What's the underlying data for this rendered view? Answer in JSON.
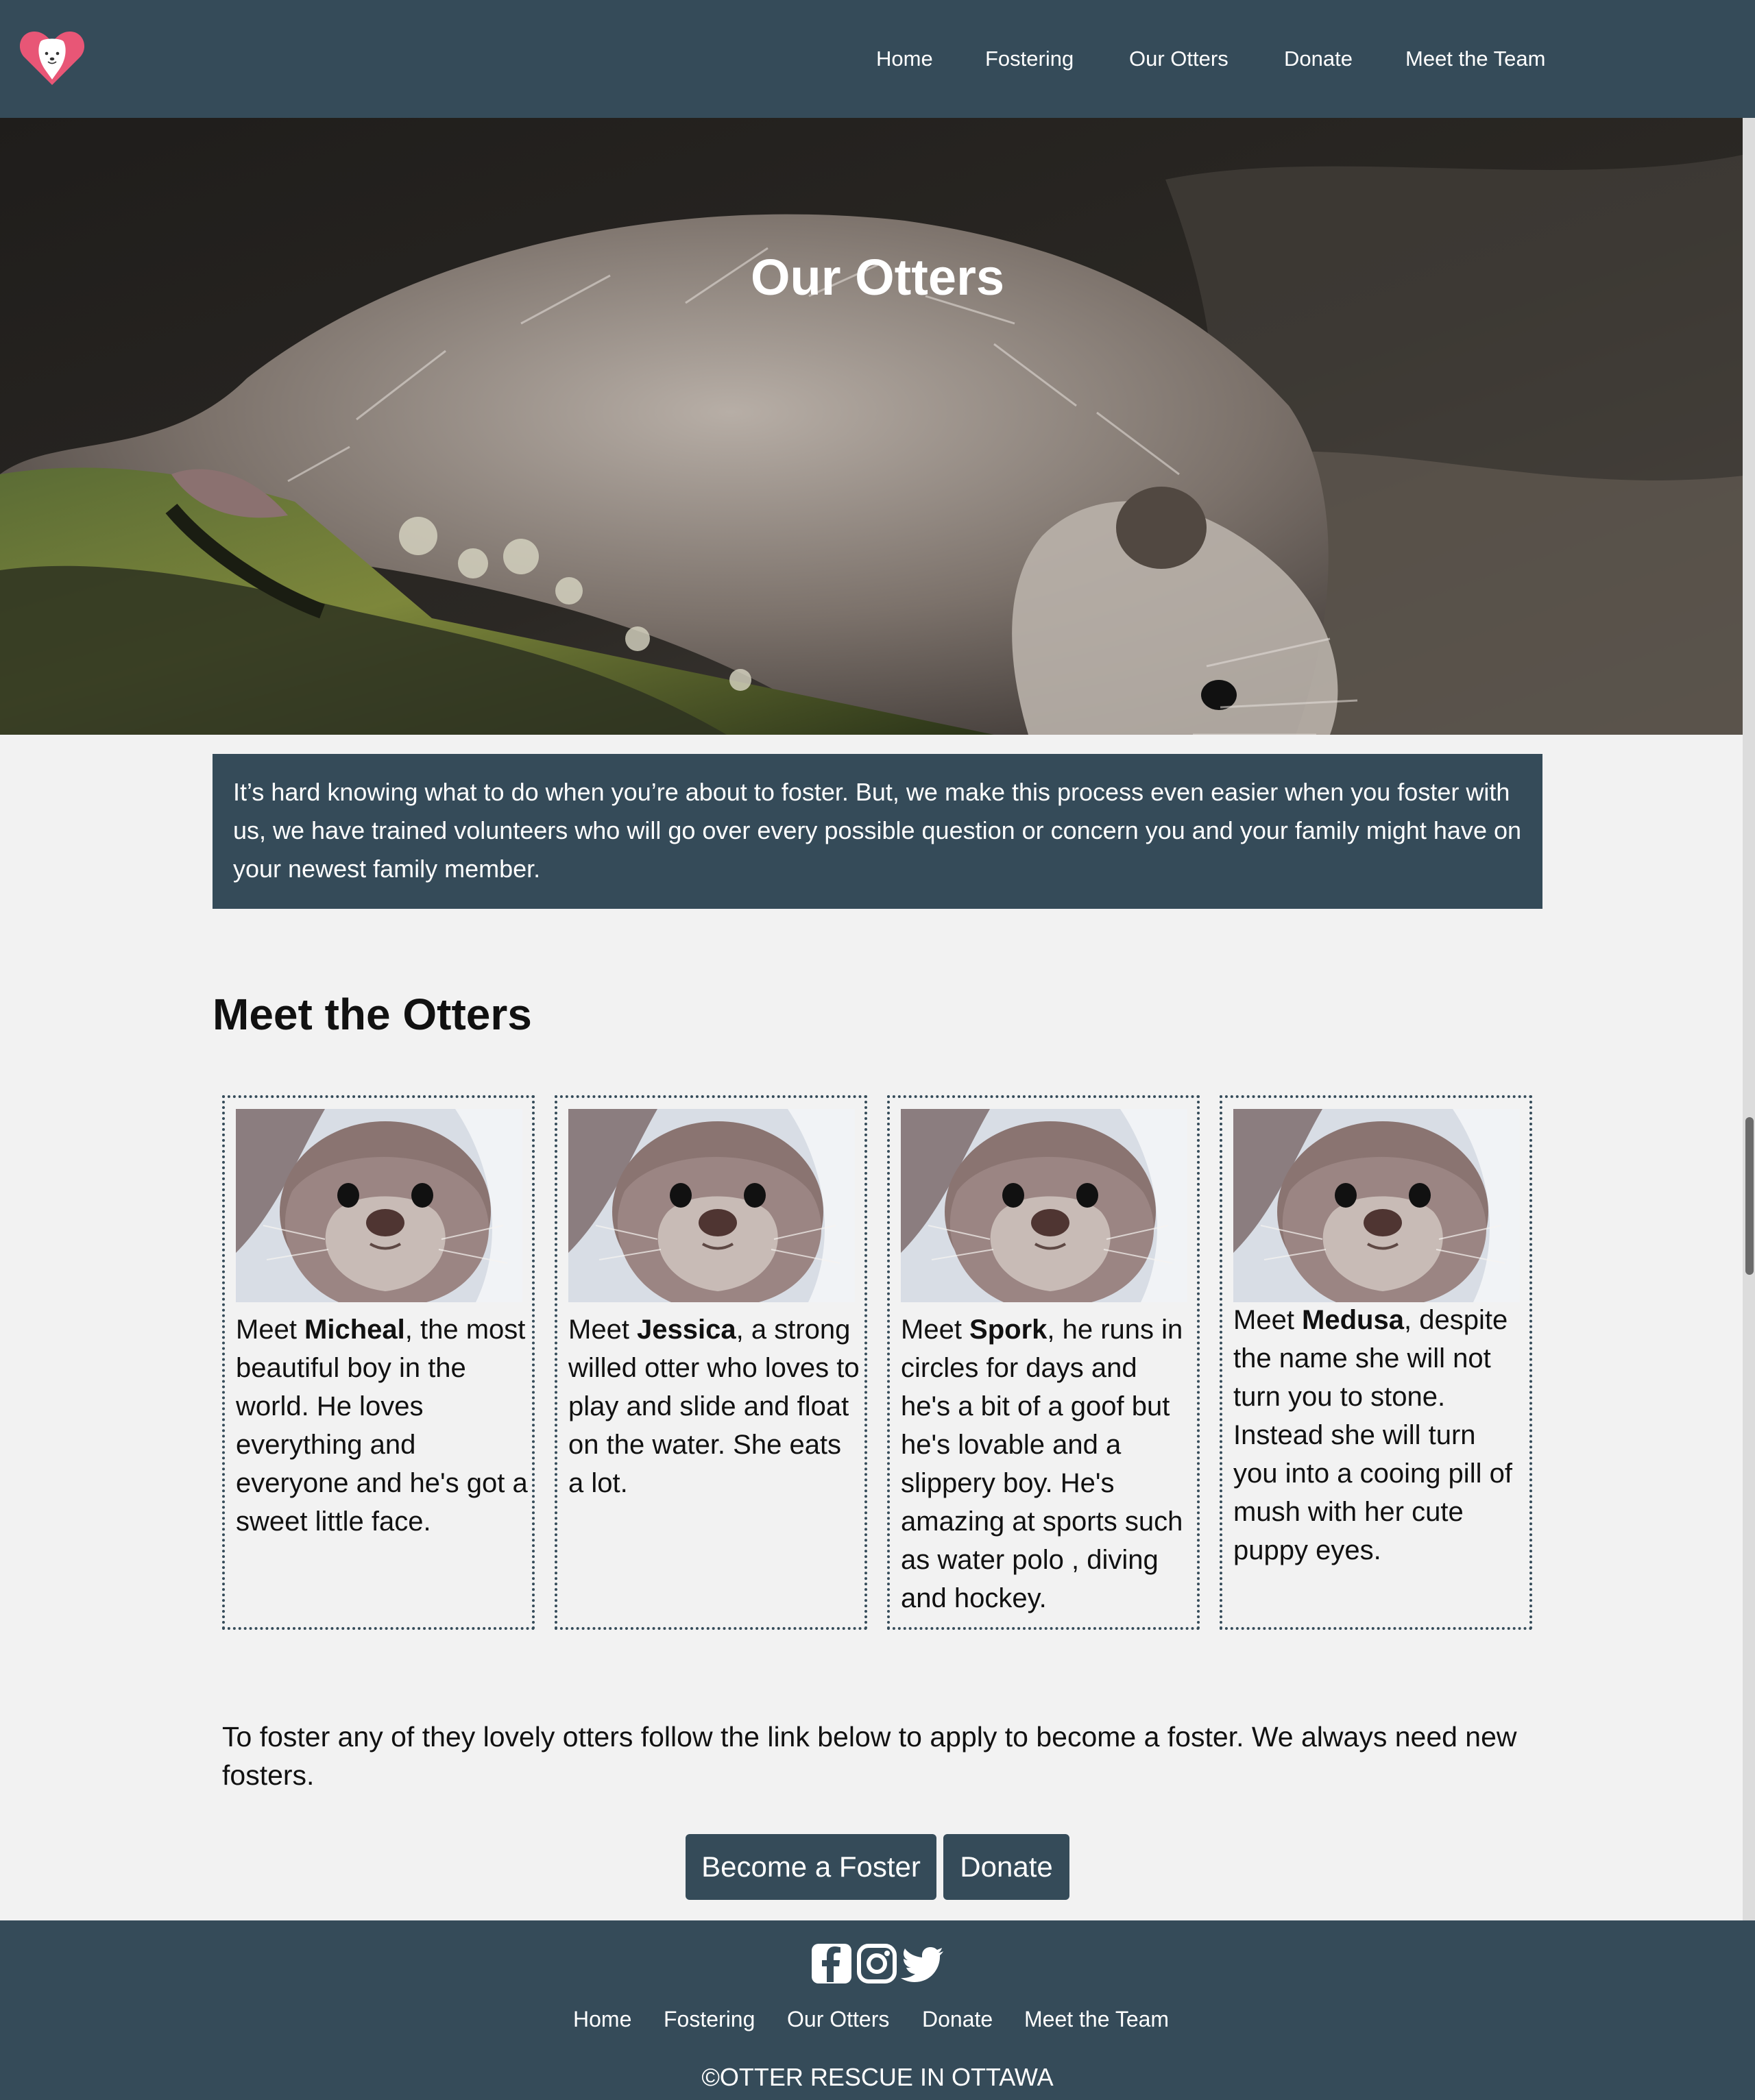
{
  "nav": {
    "logo_alt": "Otter heart logo",
    "links": [
      "Home",
      "Fostering",
      "Our Otters",
      "Donate",
      "Meet the Team"
    ]
  },
  "hero": {
    "title": "Our Otters"
  },
  "intro": {
    "text": "It’s hard knowing what to do when you’re about to foster. But, we make this process even easier when you foster with us, we have trained volunteers who will go over every possible question or concern you and your family might have on your newest family member."
  },
  "otters": {
    "section_title": "Meet the Otters",
    "cards": [
      {
        "prefix": "Meet ",
        "name": "Micheal",
        "text": ", the most beautiful boy in the world. He loves everything and everyone and he's got a sweet little face."
      },
      {
        "prefix": "Meet ",
        "name": "Jessica",
        "text": ", a strong willed otter who loves to play and slide and float on the water. She eats a lot."
      },
      {
        "prefix": "Meet ",
        "name": "Spork",
        "text": ", he runs in circles for days and he's a bit of a goof but he's lovable and a slippery boy. He's amazing at sports such as water polo , diving and hockey."
      },
      {
        "prefix": "Meet ",
        "name": "Medusa",
        "text": ", despite the name she will not turn you to stone. Instead she will turn you into a cooing pill of mush with her cute puppy eyes."
      }
    ]
  },
  "cta": {
    "text": "To foster any of they lovely otters follow the link below to apply to become a foster. We always need new fosters.",
    "become_foster": "Become a Foster",
    "donate": "Donate"
  },
  "footer": {
    "social": [
      "facebook-icon",
      "instagram-icon",
      "twitter-icon"
    ],
    "links": [
      "Home",
      "Fostering",
      "Our Otters",
      "Donate",
      "Meet the Team"
    ],
    "copyright": "©OTTER RESCUE IN OTTAWA"
  },
  "colors": {
    "primary": "#354b59",
    "background": "#f2f2f2",
    "heart": "#e85676"
  }
}
